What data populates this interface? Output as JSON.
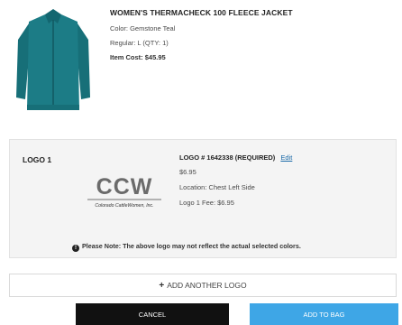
{
  "product": {
    "title": "WOMEN'S THERMACHECK 100 FLEECE JACKET",
    "color": "Color: Gemstone Teal",
    "size_qty": "Regular: L (QTY: 1)",
    "item_cost": "Item Cost: $45.95",
    "image_color": "#1c7c86"
  },
  "logo": {
    "heading": "LOGO 1",
    "number": "LOGO # 1642338 (REQUIRED)",
    "edit_label": "Edit",
    "price": "$6.95",
    "location": "Location: Chest Left Side",
    "fee": "Logo 1 Fee: $6.95",
    "art_letters": "CCW",
    "art_caption": "Colorado CattleWomen, Inc."
  },
  "note": {
    "icon": "exclamation-circle-icon",
    "text": "Please Note: The above logo may not reflect the actual selected colors."
  },
  "actions": {
    "add_logo_label": "ADD ANOTHER LOGO",
    "cancel_label": "CANCEL",
    "add_to_bag_label": "ADD TO BAG"
  }
}
